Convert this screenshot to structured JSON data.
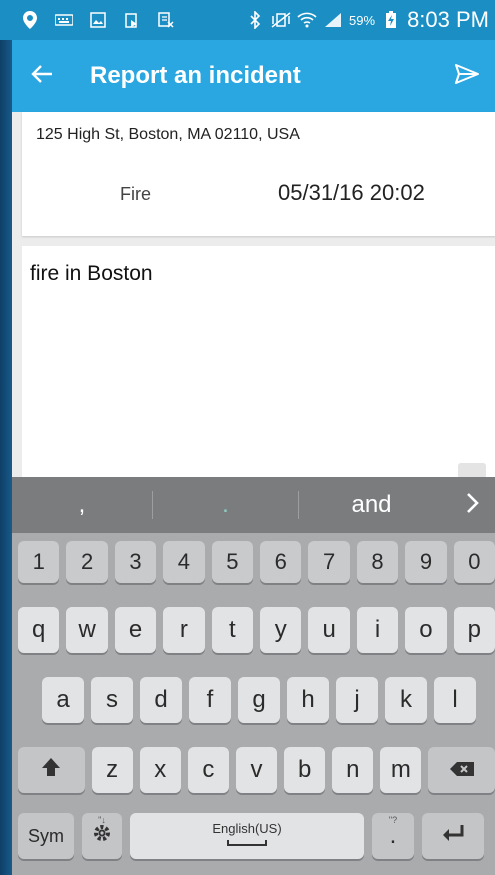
{
  "status_bar": {
    "battery_pct": "59%",
    "time": "8:03 PM"
  },
  "app_bar": {
    "title": "Report an incident",
    "back_icon": "back-arrow-icon",
    "send_icon": "send-icon"
  },
  "incident": {
    "address": "125 High St, Boston, MA 02110, USA",
    "type": "Fire",
    "datetime": "05/31/16  20:02",
    "description": "fire in Boston"
  },
  "keyboard": {
    "suggestions": [
      ",",
      ".",
      "and"
    ],
    "numbers": [
      "1",
      "2",
      "3",
      "4",
      "5",
      "6",
      "7",
      "8",
      "9",
      "0"
    ],
    "row_q": [
      "q",
      "w",
      "e",
      "r",
      "t",
      "y",
      "u",
      "i",
      "o",
      "p"
    ],
    "row_a": [
      "a",
      "s",
      "d",
      "f",
      "g",
      "h",
      "j",
      "k",
      "l"
    ],
    "row_z": [
      "z",
      "x",
      "c",
      "v",
      "b",
      "n",
      "m"
    ],
    "sym_label": "Sym",
    "space_label": "English(US)",
    "period_label": ".",
    "period_hint": "\"?",
    "settings_hint": "\"↓"
  },
  "colors": {
    "status_bar": "#1b8fc4",
    "app_bar": "#2aa7e0",
    "keyboard_bg": "#a9abad",
    "suggest_bar": "#7a7c7e"
  }
}
